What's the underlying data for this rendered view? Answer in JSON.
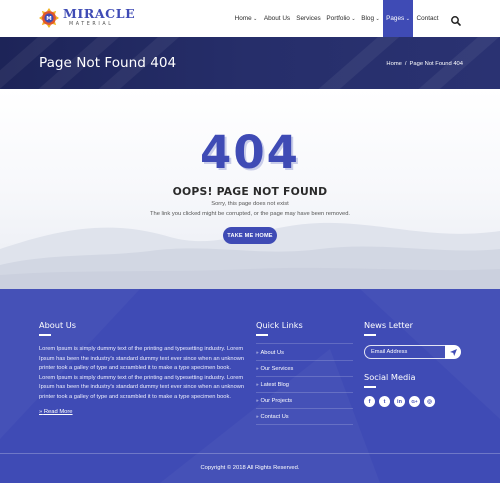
{
  "colors": {
    "brand": "#3f4bb5",
    "title_band": "#262e6a",
    "footer": "#3f4bb5",
    "text_dark": "#2a2a2a"
  },
  "logo": {
    "title": "MIRACLE",
    "subtitle": "MATERIAL",
    "icon": "gear-m-logo-icon"
  },
  "nav": {
    "items": [
      {
        "label": "Home",
        "dropdown": true,
        "active": false
      },
      {
        "label": "About Us",
        "dropdown": false,
        "active": false
      },
      {
        "label": "Services",
        "dropdown": false,
        "active": false
      },
      {
        "label": "Portfolio",
        "dropdown": true,
        "active": false
      },
      {
        "label": "Blog",
        "dropdown": true,
        "active": false
      },
      {
        "label": "Pages",
        "dropdown": true,
        "active": true
      },
      {
        "label": "Contact",
        "dropdown": false,
        "active": false
      }
    ],
    "dropdown_glyph": "⌄",
    "search_icon": "search-icon"
  },
  "title_band": {
    "title": "Page Not Found 404",
    "breadcrumb": {
      "home": "Home",
      "separator": "/",
      "current": "Page Not Found 404"
    }
  },
  "error": {
    "code": "404",
    "heading": "OOPS! PAGE NOT FOUND",
    "line1": "Sorry, this page does not exist",
    "line2": "The link you clicked might be corrupted, or the page may have been removed.",
    "button": "TAKE ME HOME"
  },
  "footer": {
    "about": {
      "heading": "About Us",
      "text": "Lorem Ipsum is simply dummy text of the printing and typesetting industry. Lorem Ipsum has been the industry's standard dummy text ever since when an unknown printer took a galley of type and scrambled it to make a type specimen book. Lorem Ipsum is simply dummy text of the printing and typesetting industry. Lorem Ipsum has been the industry's standard dummy text ever since when an unknown printer took a galley of type and scrambled it to make a type specimen book.",
      "read_more": "Read More",
      "arrow": "»"
    },
    "quick_links": {
      "heading": "Quick Links",
      "arrow": "»",
      "items": [
        "About Us",
        "Our Services",
        "Latest Blog",
        "Our Projects",
        "Contact Us"
      ]
    },
    "newsletter": {
      "heading": "News Letter",
      "placeholder": "Email Address",
      "send_icon": "paper-plane-icon"
    },
    "social": {
      "heading": "Social Media",
      "icons": [
        {
          "name": "facebook-icon",
          "glyph": "f"
        },
        {
          "name": "twitter-icon",
          "glyph": "t"
        },
        {
          "name": "linkedin-icon",
          "glyph": "in"
        },
        {
          "name": "google-plus-icon",
          "glyph": "G+"
        },
        {
          "name": "instagram-icon",
          "glyph": "◎"
        }
      ]
    },
    "copyright": "Copyright © 2018 All Rights Reserved."
  }
}
